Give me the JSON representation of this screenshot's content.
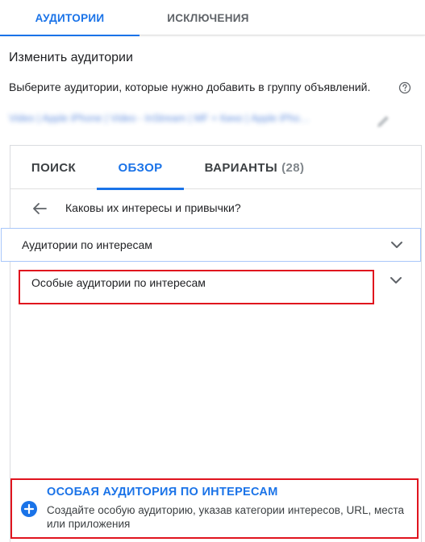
{
  "top_tabs": [
    {
      "label": "АУДИТОРИИ"
    },
    {
      "label": "ИСКЛЮЧЕНИЯ"
    }
  ],
  "page_title": "Изменить аудитории",
  "instruction": "Выберите аудитории, которые нужно добавить в группу объявлений.",
  "adgroup_path": "Video | Apple iPhone | Video - InStream | MF + Кино | Apple iPho…",
  "inner_tabs": [
    {
      "label": "ПОИСК"
    },
    {
      "label": "ОБЗОР"
    },
    {
      "label": "ВАРИАНТЫ",
      "count": "(28)"
    }
  ],
  "breadcrumb": "Каковы их интересы и привычки?",
  "categories": [
    {
      "label": "Аудитории по интересам"
    },
    {
      "label": "Особые аудитории по интересам"
    }
  ],
  "create": {
    "title": "ОСОБАЯ АУДИТОРИЯ ПО ИНТЕРЕСАМ",
    "description": "Создайте особую аудиторию, указав категории интересов, URL, места или приложения"
  },
  "colors": {
    "accent": "#1a73e8",
    "highlight": "#e0141e"
  },
  "icons": [
    "help-icon",
    "pencil-icon",
    "back-arrow-icon",
    "chevron-down-icon",
    "plus-circle-icon"
  ]
}
